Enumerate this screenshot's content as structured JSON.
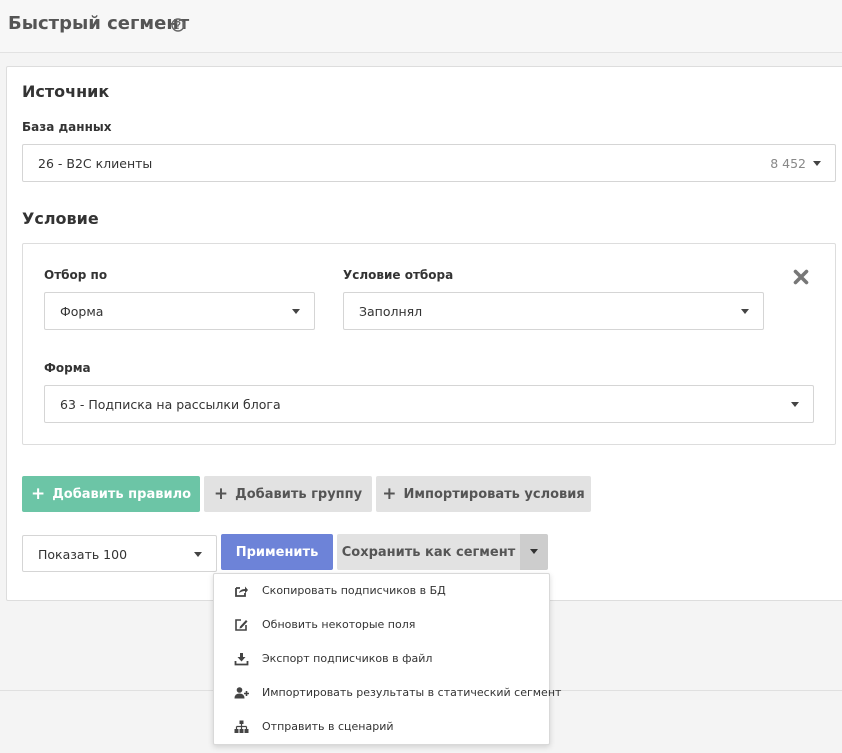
{
  "header": {
    "title": "Быстрый сегмент",
    "help_icon": "question-circle-icon"
  },
  "source": {
    "heading": "Источник",
    "database_label": "База данных",
    "database_value": "26 - B2C клиенты",
    "database_count": "8 452"
  },
  "condition": {
    "heading": "Условие",
    "filter_by_label": "Отбор по",
    "filter_by_value": "Форма",
    "filter_condition_label": "Условие отбора",
    "filter_condition_value": "Заполнял",
    "form_label": "Форма",
    "form_value": "63 - Подписка на рассылки блога",
    "remove_icon": "close-x-icon"
  },
  "rule_buttons": {
    "add_rule": "Добавить правило",
    "add_group": "Добавить группу",
    "import_conditions": "Импортировать условия"
  },
  "actions": {
    "show_value": "Показать 100",
    "apply": "Применить",
    "save_as_segment": "Сохранить как сегмент"
  },
  "dropdown_menu": [
    {
      "label": "Скопировать подписчиков в БД",
      "icon": "share-square-icon"
    },
    {
      "label": "Обновить некоторые поля",
      "icon": "edit-icon"
    },
    {
      "label": "Экспорт подписчиков в файл",
      "icon": "download-icon"
    },
    {
      "label": "Импортировать результаты в статический сегмент",
      "icon": "user-plus-icon"
    },
    {
      "label": "Отправить в сценарий",
      "icon": "sitemap-icon"
    }
  ],
  "colors": {
    "green_button": "#6cc5a6",
    "blue_button": "#6d83d8",
    "grey_button": "#e2e2e2"
  }
}
